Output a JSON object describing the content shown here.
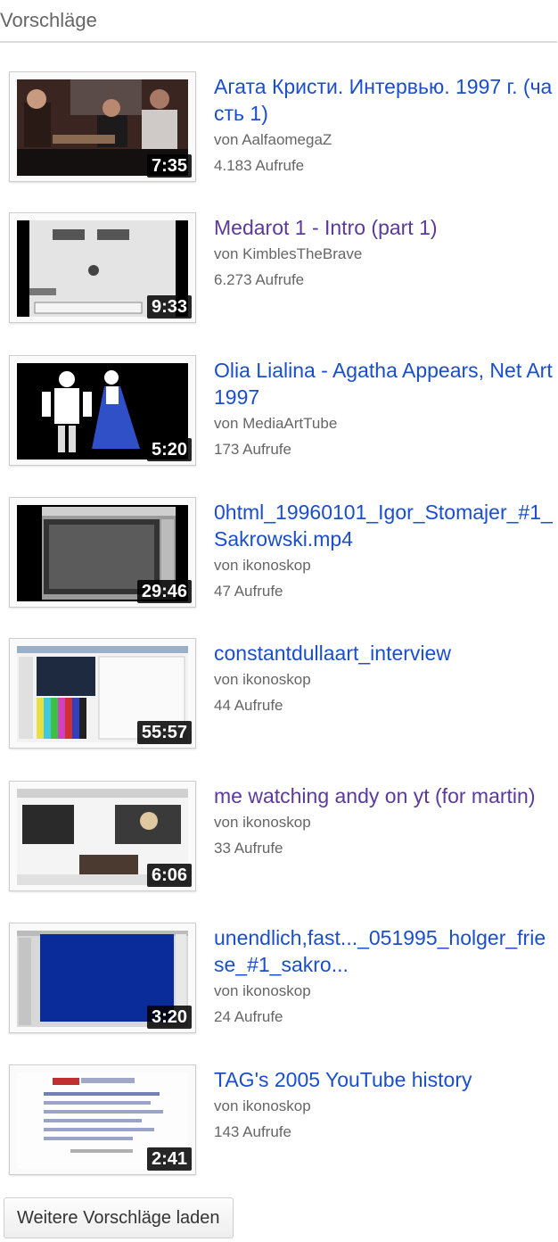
{
  "section": {
    "title": "Vorschläge"
  },
  "videos": [
    {
      "title": "Агата Кристи. Интервью. 1997 г. (часть 1)",
      "channel": "von AalfaomegaZ",
      "views": "4.183 Aufrufe",
      "duration": "7:35",
      "visited": false
    },
    {
      "title": "Medarot 1 - Intro (part 1)",
      "channel": "von KimblesTheBrave",
      "views": "6.273 Aufrufe",
      "duration": "9:33",
      "visited": true
    },
    {
      "title": "Olia Lialina - Agatha Appears, Net Art 1997",
      "channel": "von MediaArtTube",
      "views": "173 Aufrufe",
      "duration": "5:20",
      "visited": false
    },
    {
      "title": "0html_19960101_Igor_Stomajer_#1_Sakrowski.mp4",
      "channel": "von ikonoskop",
      "views": "47 Aufrufe",
      "duration": "29:46",
      "visited": false
    },
    {
      "title": "constantdullaart_interview",
      "channel": "von ikonoskop",
      "views": "44 Aufrufe",
      "duration": "55:57",
      "visited": false
    },
    {
      "title": "me watching andy on yt (for martin)",
      "channel": "von ikonoskop",
      "views": "33 Aufrufe",
      "duration": "6:06",
      "visited": true
    },
    {
      "title": "unendlich,fast..._051995_holger_friese_#1_sakro...",
      "channel": "von ikonoskop",
      "views": "24 Aufrufe",
      "duration": "3:20",
      "visited": false
    },
    {
      "title": "TAG's 2005 YouTube history",
      "channel": "von ikonoskop",
      "views": "143 Aufrufe",
      "duration": "2:41",
      "visited": false
    }
  ],
  "load_more": {
    "label": "Weitere Vorschläge laden"
  },
  "colors": {
    "link": "#1a4ecc",
    "visited_link": "#5a3a9a",
    "meta": "#666666",
    "divider": "#dddddd"
  }
}
